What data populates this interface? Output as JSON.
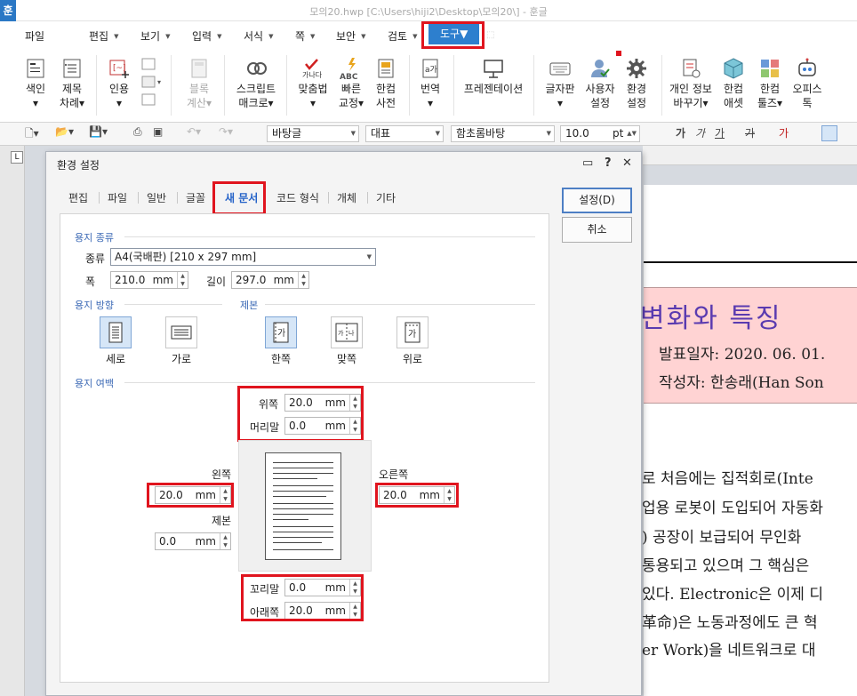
{
  "window": {
    "title": "모의20.hwp [C:\\Users\\hiji2\\Desktop\\모의20\\] - 훈글",
    "app_icon": "훈"
  },
  "menu": {
    "file": "파일",
    "edit": "편집",
    "view": "보기",
    "insert": "입력",
    "format": "서식",
    "page": "쪽",
    "security": "보안",
    "review": "검토",
    "tools": "도구"
  },
  "ribbon": {
    "index": [
      "색인",
      "▾"
    ],
    "toc": [
      "제목",
      "차례▾"
    ],
    "cite": [
      "인용",
      "▾"
    ],
    "block_calc": [
      "블록",
      "계산▾"
    ],
    "script": [
      "스크립트",
      "매크로▾"
    ],
    "spell": [
      "맞춤법",
      "▾"
    ],
    "quick": [
      "빠른",
      "교정▾"
    ],
    "dict": [
      "한컴",
      "사전"
    ],
    "translate": [
      "번역",
      "▾"
    ],
    "present": "프레젠테이션",
    "keyboard": [
      "글자판",
      "▾"
    ],
    "user_settings": [
      "사용자",
      "설정"
    ],
    "env_settings": [
      "환경",
      "설정"
    ],
    "privacy": [
      "개인 정보",
      "바꾸기▾"
    ],
    "asset": [
      "한컴",
      "애셋"
    ],
    "tools": [
      "한컴",
      "툴즈▾"
    ],
    "office": [
      "오피스",
      "톡"
    ],
    "spell_icon_text": "가나다",
    "abc_icon_text": "ABC",
    "trans_icon_text": "a가"
  },
  "format_bar": {
    "style": "바탕글",
    "shape": "대표",
    "font": "함초롬바탕",
    "size": "10.0",
    "unit": "pt",
    "bold": "가",
    "italic": "가",
    "underline": "가",
    "strike": "가",
    "color": "가"
  },
  "dialog": {
    "title": "환경 설정",
    "tabs": [
      "편집",
      "파일",
      "일반",
      "글꼴",
      "새 문서",
      "코드 형식",
      "개체",
      "기타"
    ],
    "ok": "설정(D)",
    "cancel": "취소",
    "paper_type_section": "용지 종류",
    "type_label": "종류",
    "paper_value": "A4(국배판)  [210 x 297 mm]",
    "width_label": "폭",
    "width_value": "210.0",
    "width_unit": "mm",
    "height_label": "길이",
    "height_value": "297.0",
    "height_unit": "mm",
    "orientation_section": "용지 방향",
    "binding_section": "제본",
    "portrait": "세로",
    "landscape": "가로",
    "single": "한쪽",
    "facing": "맞쪽",
    "top": "위로",
    "margin_section": "용지 여백",
    "top_label": "위쪽",
    "top_value": "20.0",
    "header_label": "머리말",
    "header_value": "0.0",
    "left_label": "왼쪽",
    "left_value": "20.0",
    "right_label": "오른쪽",
    "right_value": "20.0",
    "gutter_label": "제본",
    "gutter_value": "0.0",
    "footer_label": "꼬리말",
    "footer_value": "0.0",
    "bottom_label": "아래쪽",
    "bottom_value": "20.0",
    "mm": "mm"
  },
  "document": {
    "title": "변화와 특징",
    "date": "발표일자: 2020. 06. 01.",
    "author": "작성자: 한송래(Han Son",
    "lines": [
      "로 처음에는 집적회로(Inte",
      "업용 로봇이 도입되어 자동화",
      ") 공장이 보급되어 무인화",
      "통용되고 있으며 그 핵심은",
      "있다. Electronic은 이제 디",
      "革命)은 노동과정에도 큰 혁",
      "er Work)을 네트워크로 대"
    ]
  }
}
